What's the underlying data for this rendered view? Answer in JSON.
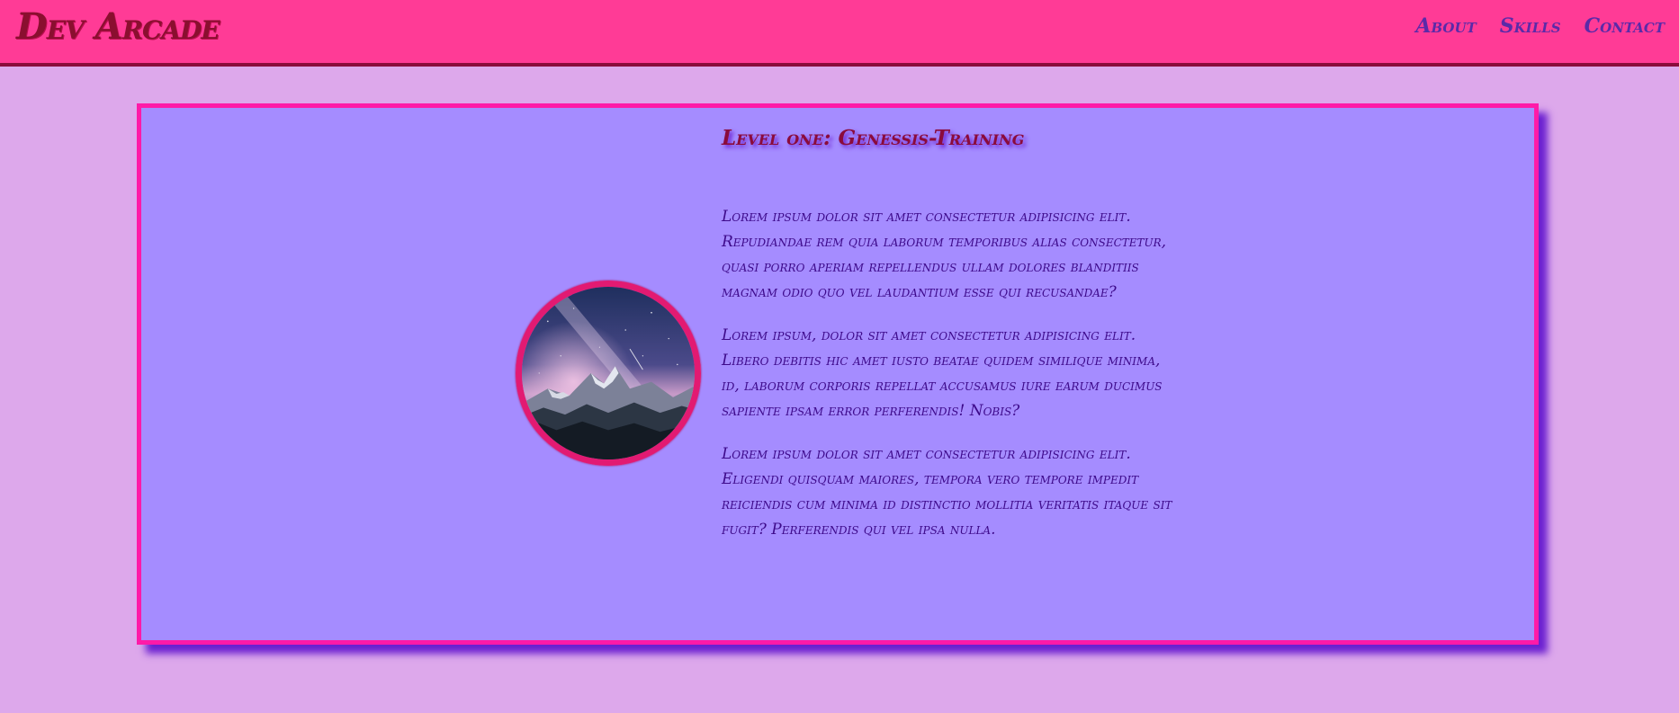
{
  "navbar": {
    "brand": "Dev Arcade",
    "links": [
      "About",
      "Skills",
      "Contact"
    ]
  },
  "card": {
    "heading": "Level one: Genessis-Training",
    "paragraphs": [
      "Lorem ipsum dolor sit amet consectetur adipisicing elit. Repudiandae rem quia laborum temporibus alias consectetur, quasi porro aperiam repellendus ullam dolores blanditiis magnam odio quo vel laudantium esse qui recusandae?",
      "Lorem ipsum, dolor sit amet consectetur adipisicing elit. Libero debitis hic amet iusto beatae quidem similique minima, id, laborum corporis repellat accusamus iure earum ducimus sapiente ipsam error perferendis! Nobis?",
      "Lorem ipsum dolor sit amet consectetur adipisicing elit. Eligendi quisquam maiores, tempora vero tempore impedit reiciendis cum minima id distinctio mollitia veritatis itaque sit fugit? Perferendis qui vel ipsa nulla."
    ]
  },
  "colors": {
    "page_background": "#dda8eb",
    "navbar_background": "#ff3b96",
    "brand_text": "#8a0f2f",
    "nav_link_text": "#5b2aa8",
    "card_background": "#a58cff",
    "card_border": "#ff1aa8",
    "heading_text": "#8a0b3c",
    "paragraph_text": "#3d0a8a",
    "avatar_border": "#e21a72"
  },
  "icons": {
    "avatar": "mountain-night-sky-image"
  }
}
